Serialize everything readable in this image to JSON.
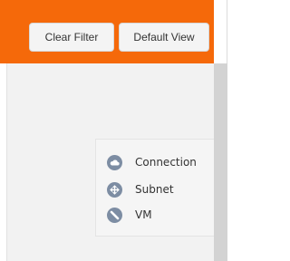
{
  "toolbar": {
    "clear_filter_label": "Clear Filter",
    "default_view_label": "Default View",
    "accent_color": "#f5690a"
  },
  "legend": {
    "items": [
      {
        "label": "Connection",
        "icon": "cloud-icon",
        "color": "#7d8da3"
      },
      {
        "label": "Subnet",
        "icon": "network-icon",
        "color": "#7d8da3"
      },
      {
        "label": "VM",
        "icon": "vm-icon",
        "color": "#7d8da3"
      }
    ]
  }
}
